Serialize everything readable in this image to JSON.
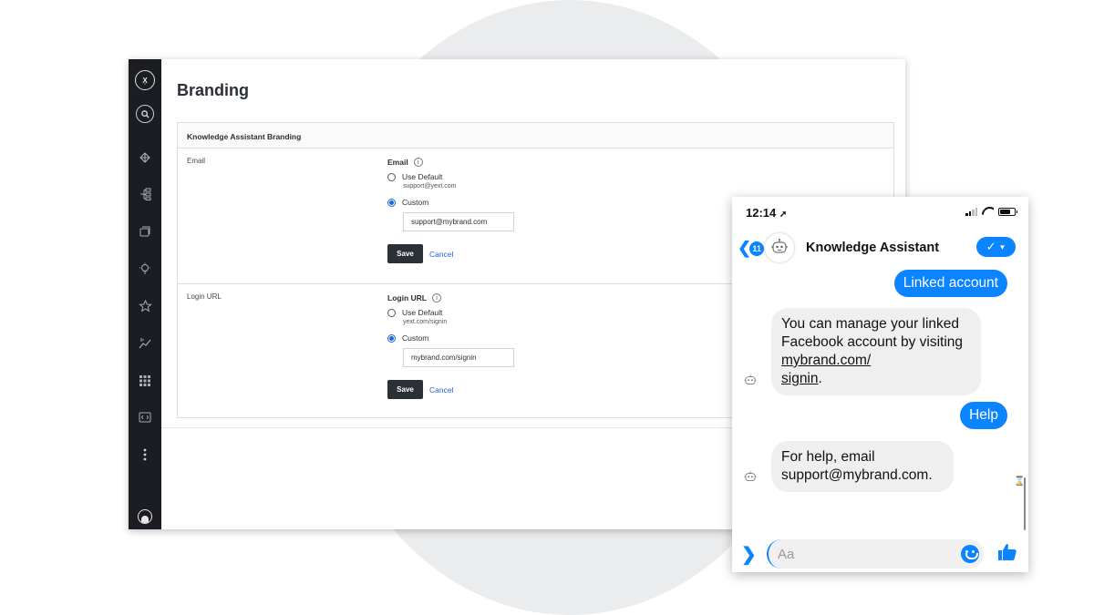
{
  "dashboard": {
    "logo_text": "X̣",
    "page_title": "Branding",
    "card_title": "Knowledge Assistant Branding",
    "email_section": {
      "row_label": "Email",
      "field_title": "Email",
      "option_default": "Use Default",
      "default_value": "support@yext.com",
      "option_custom": "Custom",
      "custom_value": "support@mybrand.com",
      "save_label": "Save",
      "cancel_label": "Cancel"
    },
    "login_section": {
      "row_label": "Login URL",
      "field_title": "Login URL",
      "option_default": "Use Default",
      "default_value": "yext.com/signin",
      "option_custom": "Custom",
      "custom_value": "mybrand.com/signin",
      "save_label": "Save",
      "cancel_label": "Cancel"
    },
    "sidebar_icons": [
      "logo-icon",
      "search-icon",
      "network-icon",
      "hierarchy-icon",
      "pages-icon",
      "lightbulb-icon",
      "reviews-icon",
      "analytics-icon",
      "apps-grid-icon",
      "code-icon",
      "more-icon",
      "user-icon"
    ]
  },
  "phone": {
    "time": "12:14",
    "back_badge": "11",
    "chat_name": "Knowledge Assistant",
    "messages": [
      {
        "from": "user",
        "text": "Linked account"
      },
      {
        "from": "bot",
        "text_pre": "You can manage your linked Facebook account by visiting ",
        "link": "mybrand.com/\nsignin",
        "text_post": "."
      },
      {
        "from": "user",
        "text": "Help"
      },
      {
        "from": "bot",
        "text": "For help, email support@mybrand.com."
      }
    ],
    "input_placeholder": "Aa",
    "accent": "#0a84ff"
  }
}
